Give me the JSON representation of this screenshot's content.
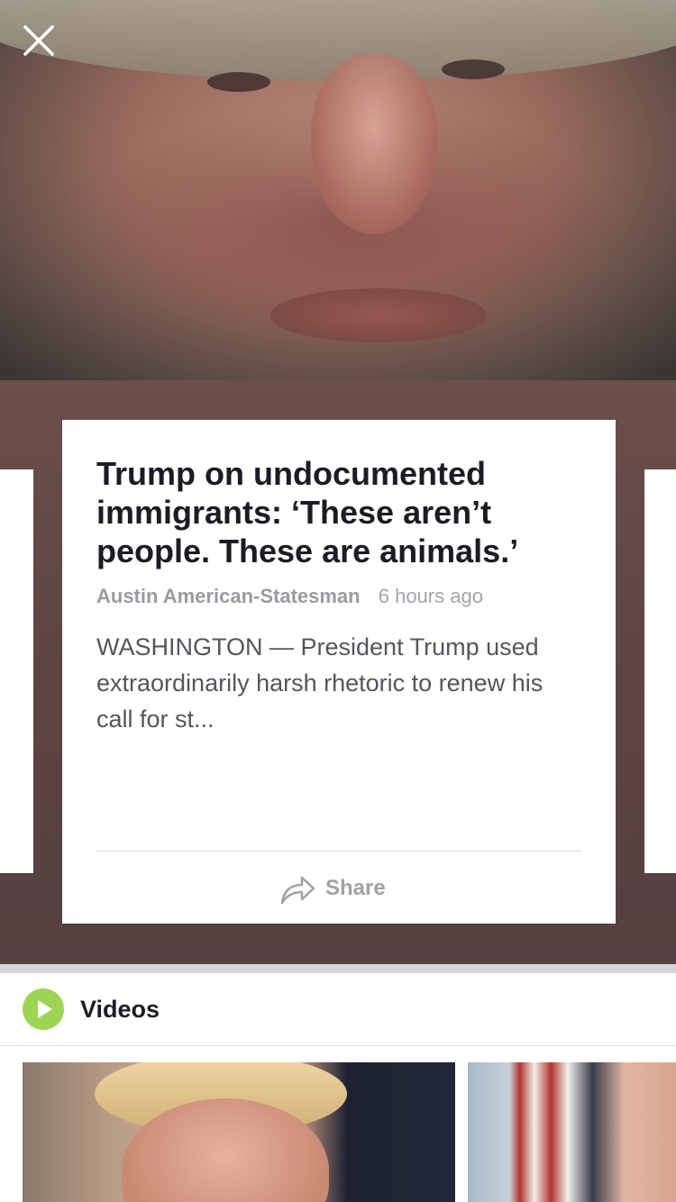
{
  "story": {
    "title": "Trump on undocumented immigrants: ‘These aren’t people. These are animals.’",
    "source": "Austin American-Statesman",
    "timestamp": "6 hours ago",
    "summary": "WASHINGTON — President Trump used extraordinarily harsh rhetoric to renew his call for st...",
    "share_label": "Share"
  },
  "videos": {
    "header_label": "Videos"
  },
  "icons": {
    "close": "close-icon",
    "share": "share-icon",
    "play": "play-icon"
  },
  "colors": {
    "play_accent": "#9bd553",
    "background_tint": "#5d4543"
  }
}
